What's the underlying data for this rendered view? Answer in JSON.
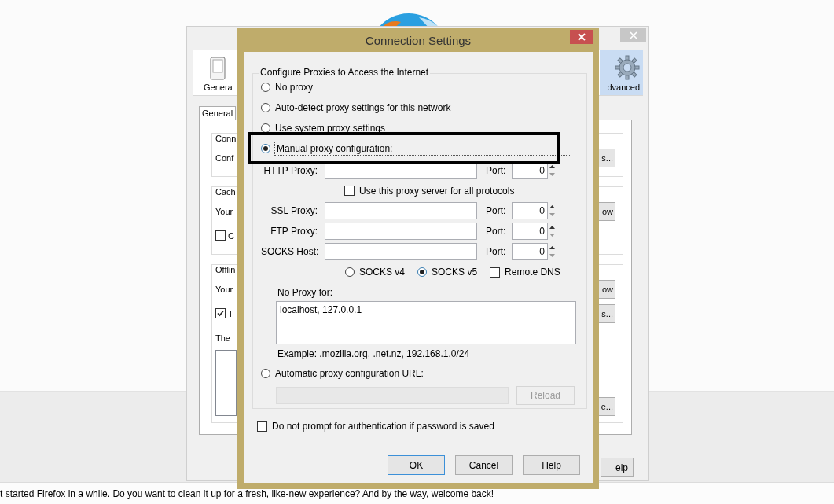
{
  "notification_bar": {
    "text": "t started Firefox in a while. Do you want to clean it up for a fresh, like-new experience? And by the way, welcome back!"
  },
  "options_window": {
    "toolbar": [
      {
        "label": "Genera",
        "kind": "general",
        "selected": false
      },
      {
        "label": "dvanced",
        "kind": "advanced",
        "selected": true
      }
    ],
    "tabs": [
      {
        "label": "General",
        "selected": true
      }
    ],
    "groups": [
      {
        "title": "Conn",
        "rows": [
          {
            "kind": "text",
            "text": "Conf",
            "button": "s..."
          }
        ]
      },
      {
        "title": "Cach",
        "rows": [
          {
            "kind": "text",
            "text": "Your",
            "button": "ow"
          },
          {
            "kind": "checkbox",
            "checked": false,
            "text": "C"
          }
        ]
      },
      {
        "title": "Offlin",
        "rows": [
          {
            "kind": "text",
            "text": "Your",
            "button": "ow"
          },
          {
            "kind": "checkbox",
            "checked": true,
            "text": "T",
            "button": "s..."
          },
          {
            "kind": "text",
            "text": "The"
          },
          {
            "kind": "textarea",
            "button": "e..."
          }
        ]
      }
    ],
    "help_button": "elp"
  },
  "dialog": {
    "title": "Connection Settings",
    "group_title": "Configure Proxies to Access the Internet",
    "proxy_modes": [
      {
        "label": "No proxy",
        "selected": false
      },
      {
        "label": "Auto-detect proxy settings for this network",
        "selected": false
      },
      {
        "label": "Use system proxy settings",
        "selected": false
      },
      {
        "label": "Manual proxy configuration:",
        "selected": true
      }
    ],
    "http_proxy": {
      "label": "HTTP Proxy:",
      "port_label": "Port:",
      "port": "0"
    },
    "share_all": {
      "label": "Use this proxy server for all protocols",
      "checked": false
    },
    "proxies": [
      {
        "label": "SSL Proxy:",
        "port_label": "Port:",
        "port": "0"
      },
      {
        "label": "FTP Proxy:",
        "port_label": "Port:",
        "port": "0"
      },
      {
        "label": "SOCKS Host:",
        "port_label": "Port:",
        "port": "0"
      }
    ],
    "socks_versions": [
      {
        "label": "SOCKS v4",
        "selected": false
      },
      {
        "label": "SOCKS v5",
        "selected": true
      }
    ],
    "remote_dns": {
      "label": "Remote DNS",
      "checked": false
    },
    "no_proxy_label": "No Proxy for:",
    "no_proxy_value": "localhost, 127.0.0.1",
    "example": "Example: .mozilla.org, .net.nz, 192.168.1.0/24",
    "auto_config": {
      "label": "Automatic proxy configuration URL:",
      "selected": false,
      "reload": "Reload",
      "disabled": true
    },
    "auth_checkbox": {
      "label": "Do not prompt for authentication if password is saved",
      "checked": false
    },
    "buttons": [
      {
        "label": "OK",
        "kind": "default"
      },
      {
        "label": "Cancel",
        "kind": "normal"
      },
      {
        "label": "Help",
        "kind": "normal"
      }
    ]
  }
}
